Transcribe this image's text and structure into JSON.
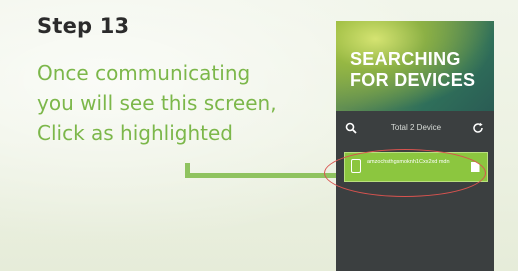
{
  "step": {
    "title": "Step 13",
    "lines": [
      "Once communicating",
      "you will see this screen,",
      "Click as highlighted"
    ]
  },
  "phone": {
    "header_title_line1": "SEARCHING",
    "header_title_line2": "FOR DEVICES",
    "device_count": "Total 2 Device",
    "device_row": {
      "name": "amzochsthgsmoknh1Cxx2xd mdn",
      "action_icon": "file-icon"
    },
    "icons": {
      "search": "search-icon",
      "refresh": "refresh-icon",
      "device": "phone-icon"
    }
  },
  "colors": {
    "step_text": "#7cb74a",
    "title_text": "#2b2b2b",
    "highlight": "#d9534f",
    "device_row": "#8cc63f",
    "phone_bg": "#3b3f40"
  }
}
